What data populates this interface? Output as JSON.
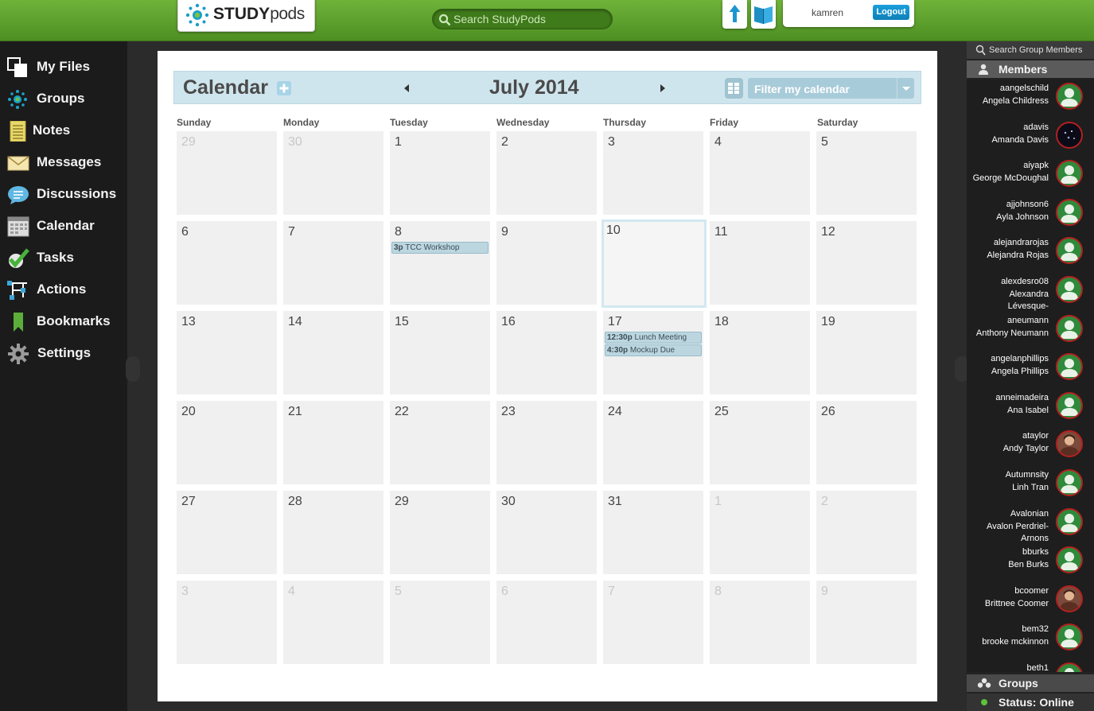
{
  "app": {
    "brand_bold": "STUDY",
    "brand_light": "pods"
  },
  "header": {
    "search_placeholder": "Search StudyPods",
    "username": "kamren",
    "logout_label": "Logout"
  },
  "nav": [
    {
      "label": "My Files",
      "icon": "files-icon"
    },
    {
      "label": "Groups",
      "icon": "groups-icon"
    },
    {
      "label": "Notes",
      "icon": "notes-icon"
    },
    {
      "label": "Messages",
      "icon": "envelope-icon"
    },
    {
      "label": "Discussions",
      "icon": "discussion-icon"
    },
    {
      "label": "Calendar",
      "icon": "calendar-icon"
    },
    {
      "label": "Tasks",
      "icon": "checkmark-icon"
    },
    {
      "label": "Actions",
      "icon": "actions-icon"
    },
    {
      "label": "Bookmarks",
      "icon": "bookmark-icon"
    },
    {
      "label": "Settings",
      "icon": "gear-icon"
    }
  ],
  "calendar": {
    "title": "Calendar",
    "month": "July 2014",
    "filter_label": "Filter my calendar",
    "weekdays": [
      "Sunday",
      "Monday",
      "Tuesday",
      "Wednesday",
      "Thursday",
      "Friday",
      "Saturday"
    ],
    "today": "10",
    "weeks": [
      [
        {
          "d": "29",
          "o": true
        },
        {
          "d": "30",
          "o": true
        },
        {
          "d": "1"
        },
        {
          "d": "2"
        },
        {
          "d": "3"
        },
        {
          "d": "4"
        },
        {
          "d": "5"
        }
      ],
      [
        {
          "d": "6"
        },
        {
          "d": "7"
        },
        {
          "d": "8"
        },
        {
          "d": "9"
        },
        {
          "d": "10",
          "today": true
        },
        {
          "d": "11"
        },
        {
          "d": "12"
        }
      ],
      [
        {
          "d": "13"
        },
        {
          "d": "14"
        },
        {
          "d": "15"
        },
        {
          "d": "16"
        },
        {
          "d": "17"
        },
        {
          "d": "18"
        },
        {
          "d": "19"
        }
      ],
      [
        {
          "d": "20"
        },
        {
          "d": "21"
        },
        {
          "d": "22"
        },
        {
          "d": "23"
        },
        {
          "d": "24"
        },
        {
          "d": "25"
        },
        {
          "d": "26"
        }
      ],
      [
        {
          "d": "27"
        },
        {
          "d": "28"
        },
        {
          "d": "29"
        },
        {
          "d": "30"
        },
        {
          "d": "31"
        },
        {
          "d": "1",
          "o": true
        },
        {
          "d": "2",
          "o": true
        }
      ],
      [
        {
          "d": "3",
          "o": true
        },
        {
          "d": "4",
          "o": true
        },
        {
          "d": "5",
          "o": true
        },
        {
          "d": "6",
          "o": true
        },
        {
          "d": "7",
          "o": true
        },
        {
          "d": "8",
          "o": true
        },
        {
          "d": "9",
          "o": true
        }
      ]
    ],
    "events": [
      {
        "week": 1,
        "day": 2,
        "time": "3p",
        "title": "TCC Workshop"
      },
      {
        "week": 2,
        "day": 4,
        "time": "12:30p",
        "title": "Lunch Meeting"
      },
      {
        "week": 2,
        "day": 4,
        "time": "4:30p",
        "title": "Mockup Due"
      }
    ]
  },
  "sidebar": {
    "search_label": "Search Group Members",
    "members_label": "Members",
    "groups_label": "Groups",
    "status_label": "Status: Online",
    "members": [
      {
        "username": "aangelschild",
        "name": "Angela Childress",
        "avatar": "default"
      },
      {
        "username": "adavis",
        "name": "Amanda Davis",
        "avatar": "dark"
      },
      {
        "username": "aiyapk",
        "name": "George McDoughal",
        "avatar": "default"
      },
      {
        "username": "ajjohnson6",
        "name": "Ayla Johnson",
        "avatar": "default"
      },
      {
        "username": "alejandrarojas",
        "name": "Alejandra Rojas",
        "avatar": "default"
      },
      {
        "username": "alexdesro08",
        "name": "Alexandra Lévesque-",
        "avatar": "default"
      },
      {
        "username": "aneumann",
        "name": "Anthony Neumann",
        "avatar": "default"
      },
      {
        "username": "angelanphillips",
        "name": "Angela Phillips",
        "avatar": "default"
      },
      {
        "username": "anneimadeira",
        "name": "Ana Isabel",
        "avatar": "default"
      },
      {
        "username": "ataylor",
        "name": "Andy Taylor",
        "avatar": "photo"
      },
      {
        "username": "Autumnsity",
        "name": "Linh Tran",
        "avatar": "default"
      },
      {
        "username": "Avalonian",
        "name": "Avalon Perdriel-Arnons",
        "avatar": "default"
      },
      {
        "username": "bburks",
        "name": "Ben Burks",
        "avatar": "default"
      },
      {
        "username": "bcoomer",
        "name": "Brittnee Coomer",
        "avatar": "photo"
      },
      {
        "username": "bem32",
        "name": "brooke mckinnon",
        "avatar": "default"
      },
      {
        "username": "beth1",
        "name": "",
        "avatar": "default"
      }
    ]
  },
  "colors": {
    "brand_green": "#5ea22e",
    "today_border": "#d2e8f1",
    "event_bg": "#bcd6e0",
    "logout_blue": "#1a9bd7"
  }
}
